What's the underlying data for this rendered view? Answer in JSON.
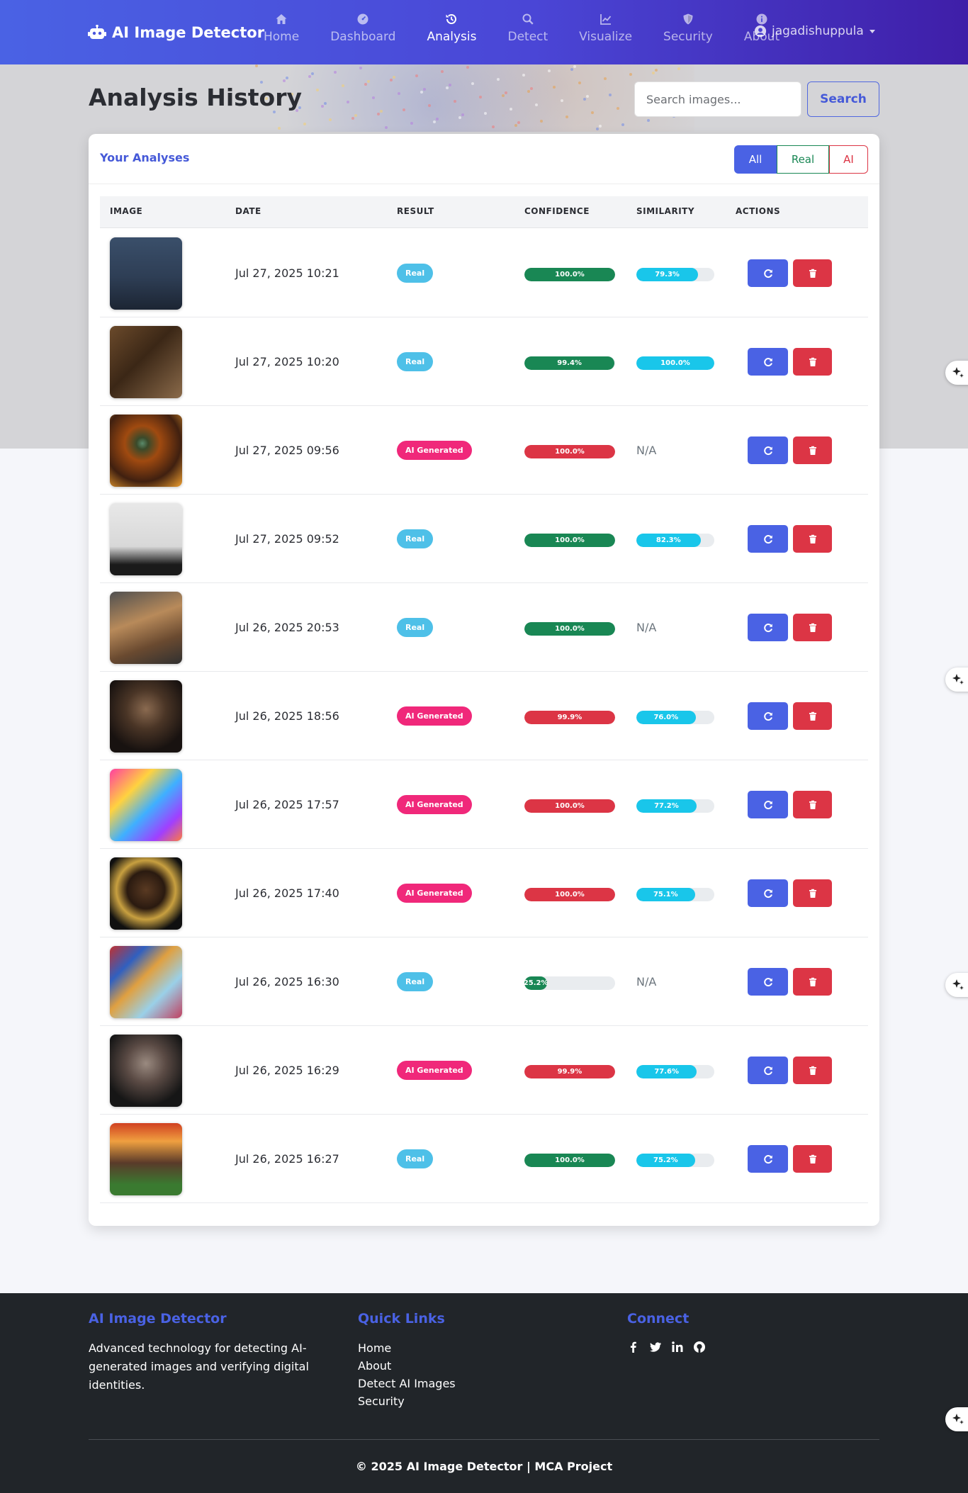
{
  "app": {
    "brand": "AI Image Detector"
  },
  "nav": {
    "items": [
      {
        "label": "Home",
        "icon": "home-icon",
        "active": false
      },
      {
        "label": "Dashboard",
        "icon": "dashboard-icon",
        "active": false
      },
      {
        "label": "Analysis",
        "icon": "history-icon",
        "active": true
      },
      {
        "label": "Detect",
        "icon": "search-icon",
        "active": false
      },
      {
        "label": "Visualize",
        "icon": "chart-line-icon",
        "active": false
      },
      {
        "label": "Security",
        "icon": "shield-icon",
        "active": false
      },
      {
        "label": "About",
        "icon": "info-icon",
        "active": false
      }
    ]
  },
  "user": {
    "name": "jagadishuppula",
    "icon": "user-circle-icon"
  },
  "page": {
    "title": "Analysis History"
  },
  "search": {
    "placeholder": "Search images...",
    "button_label": "Search"
  },
  "card": {
    "title": "Your Analyses"
  },
  "filters": {
    "all": "All",
    "real": "Real",
    "ai": "AI",
    "selected": "All"
  },
  "table": {
    "headers": {
      "image": "IMAGE",
      "date": "DATE",
      "result": "RESULT",
      "confidence": "CONFIDENCE",
      "similarity": "SIMILARITY",
      "actions": "ACTIONS"
    },
    "rows": [
      {
        "thumb": "portrait-man-suit",
        "date": "Jul 27, 2025 10:21",
        "result": "Real",
        "result_type": "real",
        "confidence": 100.0,
        "confidence_label": "100.0%",
        "similarity": 79.3,
        "similarity_label": "79.3%"
      },
      {
        "thumb": "portrait-man-beard",
        "date": "Jul 27, 2025 10:20",
        "result": "Real",
        "result_type": "real",
        "confidence": 99.4,
        "confidence_label": "99.4%",
        "similarity": 100.0,
        "similarity_label": "100.0%"
      },
      {
        "thumb": "eye-closeup",
        "date": "Jul 27, 2025 09:56",
        "result": "AI Generated",
        "result_type": "ai",
        "confidence": 100.0,
        "confidence_label": "100.0%",
        "similarity": null,
        "similarity_label": "N/A"
      },
      {
        "thumb": "portrait-woman",
        "date": "Jul 27, 2025 09:52",
        "result": "Real",
        "result_type": "real",
        "confidence": 100.0,
        "confidence_label": "100.0%",
        "similarity": 82.3,
        "similarity_label": "82.3%"
      },
      {
        "thumb": "deer-fawn",
        "date": "Jul 26, 2025 20:53",
        "result": "Real",
        "result_type": "real",
        "confidence": 100.0,
        "confidence_label": "100.0%",
        "similarity": null,
        "similarity_label": "N/A"
      },
      {
        "thumb": "portrait-elder-man",
        "date": "Jul 26, 2025 18:56",
        "result": "AI Generated",
        "result_type": "ai",
        "confidence": 99.9,
        "confidence_label": "99.9%",
        "similarity": 76.0,
        "similarity_label": "76.0%"
      },
      {
        "thumb": "colorful-face-art",
        "date": "Jul 26, 2025 17:57",
        "result": "AI Generated",
        "result_type": "ai",
        "confidence": 100.0,
        "confidence_label": "100.0%",
        "similarity": 77.2,
        "similarity_label": "77.2%"
      },
      {
        "thumb": "ornate-portrait",
        "date": "Jul 26, 2025 17:40",
        "result": "AI Generated",
        "result_type": "ai",
        "confidence": 100.0,
        "confidence_label": "100.0%",
        "similarity": 75.1,
        "similarity_label": "75.1%"
      },
      {
        "thumb": "robot-collage",
        "date": "Jul 26, 2025 16:30",
        "result": "Real",
        "result_type": "real",
        "confidence": 25.2,
        "confidence_label": "25.2%",
        "similarity": null,
        "similarity_label": "N/A"
      },
      {
        "thumb": "portrait-grey-beard",
        "date": "Jul 26, 2025 16:29",
        "result": "AI Generated",
        "result_type": "ai",
        "confidence": 99.9,
        "confidence_label": "99.9%",
        "similarity": 77.6,
        "similarity_label": "77.6%"
      },
      {
        "thumb": "portrait-child",
        "date": "Jul 26, 2025 16:27",
        "result": "Real",
        "result_type": "real",
        "confidence": 100.0,
        "confidence_label": "100.0%",
        "similarity": 75.2,
        "similarity_label": "75.2%"
      }
    ]
  },
  "footer": {
    "about_title": "AI Image Detector",
    "about_text": "Advanced technology for detecting AI-generated images and verifying digital identities.",
    "links_title": "Quick Links",
    "links": [
      "Home",
      "About",
      "Detect AI Images",
      "Security"
    ],
    "connect_title": "Connect",
    "social": [
      "facebook-icon",
      "twitter-icon",
      "linkedin-icon",
      "github-icon"
    ],
    "copyright": "© 2025 AI Image Detector | MCA Project"
  },
  "colors": {
    "primary": "#4a62e4",
    "success": "#198754",
    "danger": "#dc3545",
    "info": "#4ec0e8",
    "ai_badge": "#f0287a",
    "similarity": "#19c6ea",
    "footer_bg": "#212529"
  }
}
